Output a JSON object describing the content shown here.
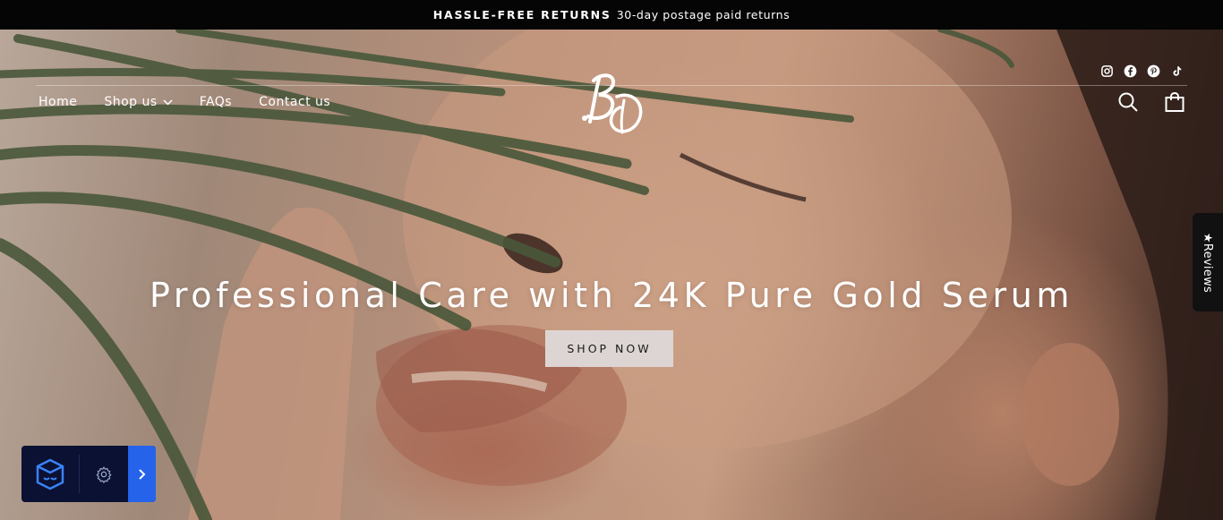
{
  "announcement": {
    "bold": "HASSLE-FREE RETURNS",
    "text": "30-day postage paid returns"
  },
  "nav": {
    "home": "Home",
    "shop": "Shop us",
    "faqs": "FAQs",
    "contact": "Contact us"
  },
  "social": [
    "instagram-icon",
    "facebook-icon",
    "pinterest-icon",
    "tiktok-icon"
  ],
  "logo": {
    "monogram": "BD"
  },
  "header_icons": [
    "search-icon",
    "cart-bag-icon"
  ],
  "reviews_tab": {
    "label": "★Reviews"
  },
  "hero": {
    "headline": "Professional Care with 24K Pure Gold Serum",
    "cta": "SHOP NOW"
  },
  "widget": {
    "icons": [
      "shield-face-icon",
      "gear-icon",
      "chevron-right-icon"
    ]
  },
  "colors": {
    "announcement_bg": "#050505",
    "button_bg": "#ddd5d3",
    "widget_bg": "#0a1133",
    "widget_accent": "#2563eb"
  }
}
